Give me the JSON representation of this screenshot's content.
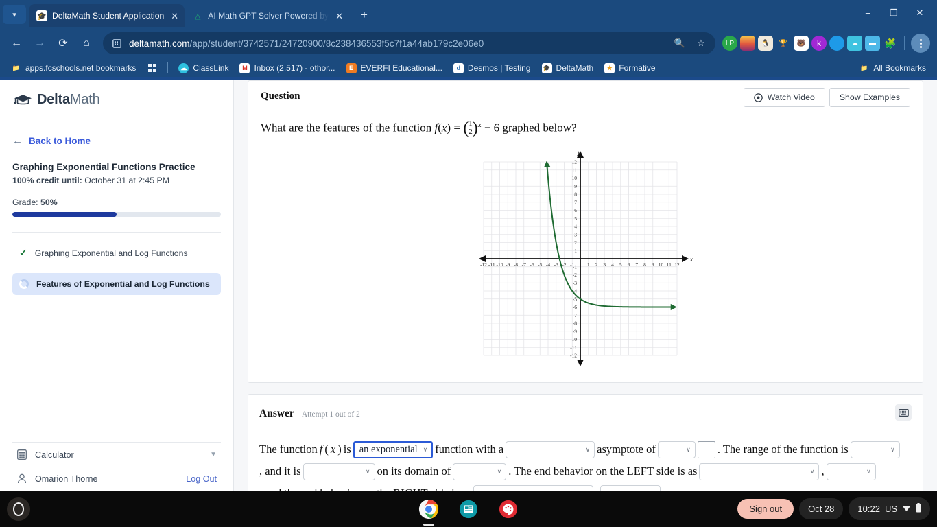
{
  "browser": {
    "tabs": [
      {
        "title": "DeltaMath Student Application",
        "favicon": "deltamath-icon",
        "active": true
      },
      {
        "title": "AI Math GPT Solver Powered by",
        "favicon": "compass-icon",
        "active": false
      }
    ],
    "newtab_label": "+",
    "window_controls": {
      "minimize": "−",
      "restore": "❐",
      "close": "✕"
    },
    "nav": {
      "back": "←",
      "forward": "→",
      "reload": "⟳",
      "home": "⌂"
    },
    "omnibox": {
      "domain": "deltamath.com",
      "path": "/app/student/3742571/24720900/8c238436553f5c7f1a44ab179c2e06e0",
      "site_icon": "page-info-icon",
      "search_icon": "search-icon",
      "bookmark_icon": "star-icon"
    },
    "extensions": [
      "lp-icon",
      "sunset-icon",
      "penguin-icon",
      "trophy-icon",
      "panda-icon",
      "k-icon",
      "pie-icon",
      "cloud-icon",
      "video-icon",
      "puzzle-icon"
    ],
    "menu_icon": "kebab-menu-icon",
    "bookmarks": [
      {
        "label": "apps.fcschools.net bookmarks",
        "icon": "folder-settings-icon"
      },
      {
        "label": "",
        "icon": "apps-grid-icon"
      },
      {
        "label": "ClassLink",
        "icon": "classlink-icon"
      },
      {
        "label": "Inbox (2,517) - othor...",
        "icon": "gmail-icon"
      },
      {
        "label": "EVERFI Educational...",
        "icon": "everfi-icon"
      },
      {
        "label": "Desmos | Testing",
        "icon": "desmos-icon"
      },
      {
        "label": "DeltaMath",
        "icon": "deltamath-icon"
      },
      {
        "label": "Formative",
        "icon": "formative-icon"
      }
    ],
    "all_bookmarks": {
      "label": "All Bookmarks",
      "icon": "folder-icon"
    }
  },
  "sidebar": {
    "logo": {
      "bold": "Delta",
      "light": "Math",
      "icon": "graduation-cap-icon"
    },
    "back_to_home": "Back to Home",
    "assignment_title": "Graphing Exponential Functions Practice",
    "credit_label": "100% credit until:",
    "credit_value": "October 31 at 2:45 PM",
    "grade_label": "Grade:",
    "grade_value": "50%",
    "grade_percent": 50,
    "problems": [
      {
        "label": "Graphing Exponential and Log Functions",
        "state": "complete",
        "icon": "check-icon"
      },
      {
        "label": "Features of Exponential and Log Functions",
        "state": "current",
        "icon": "spinner-icon"
      }
    ],
    "calculator": "Calculator",
    "user_name": "Omarion Thorne",
    "log_out": "Log Out"
  },
  "question": {
    "label": "Question",
    "watch_video": "Watch Video",
    "show_examples": "Show Examples",
    "text_before": "What are the features of the function",
    "fn_name": "f",
    "fn_var": "x",
    "equals": "=",
    "frac_num": "1",
    "frac_den": "2",
    "exponent": "x",
    "minus_const": "− 6",
    "text_after": "graphed below?"
  },
  "chart_data": {
    "type": "line",
    "title": "",
    "xlabel": "x",
    "ylabel": "y",
    "xlim": [
      -12,
      12
    ],
    "ylim": [
      -12,
      12
    ],
    "grid": true,
    "xticks": [
      -12,
      -11,
      -10,
      -9,
      -8,
      -7,
      -6,
      -5,
      -4,
      -3,
      -2,
      -1,
      1,
      2,
      3,
      4,
      5,
      6,
      7,
      8,
      9,
      10,
      11,
      12
    ],
    "yticks": [
      12,
      11,
      10,
      9,
      8,
      7,
      6,
      5,
      4,
      3,
      2,
      1,
      -1,
      -2,
      -3,
      -4,
      -5,
      -6,
      -7,
      -8,
      -9,
      -10,
      -11,
      -12
    ],
    "series": [
      {
        "name": "f(x) = (1/2)^x - 6",
        "color": "#1f6b32",
        "asymptote": -6,
        "y_intercept": -5,
        "x_intercept": -2.807,
        "points": [
          {
            "x": -4.17,
            "y": 12.0
          },
          {
            "x": -4.0,
            "y": 10.0
          },
          {
            "x": -3.5,
            "y": 5.31
          },
          {
            "x": -3.0,
            "y": 2.0
          },
          {
            "x": -2.807,
            "y": 0.0
          },
          {
            "x": -2.5,
            "y": -0.34
          },
          {
            "x": -2.0,
            "y": -2.0
          },
          {
            "x": -1.5,
            "y": -3.17
          },
          {
            "x": -1.0,
            "y": -4.0
          },
          {
            "x": -0.5,
            "y": -4.59
          },
          {
            "x": 0.0,
            "y": -5.0
          },
          {
            "x": 1.0,
            "y": -5.5
          },
          {
            "x": 2.0,
            "y": -5.75
          },
          {
            "x": 3.0,
            "y": -5.875
          },
          {
            "x": 4.0,
            "y": -5.94
          },
          {
            "x": 6.0,
            "y": -5.98
          },
          {
            "x": 9.0,
            "y": -6.0
          },
          {
            "x": 11.9,
            "y": -6.0
          }
        ]
      }
    ]
  },
  "answer": {
    "label": "Answer",
    "attempt": "Attempt 1 out of 2",
    "keyboard_icon": "keyboard-icon",
    "line1": {
      "t1": "The function",
      "fn": "f",
      "var": "x",
      "t2": "is",
      "d1_value": "an exponential",
      "t3": "function with a",
      "d2_value": "",
      "t4": "asymptote of",
      "d3_value": "",
      "input_value": "",
      "t5": ". The range of the function is"
    },
    "line2": {
      "d4_value": "",
      "t1": ", and it is",
      "d5_value": "",
      "t2": "on its domain of",
      "d6_value": "",
      "t3": ". The end behavior on the LEFT side is as",
      "d7_value": "",
      "t4": ","
    },
    "line3": {
      "d8_value": "",
      "t1": ", and the end behavior on the RIGHT side is as",
      "d9_value": "",
      "t2": ",",
      "d10_value": "",
      "t3": "."
    },
    "chevron": "∨"
  },
  "shelf": {
    "launcher": "launcher-icon",
    "apps": [
      "chrome-icon",
      "slides-icon",
      "paint-icon"
    ],
    "sign_out": "Sign out",
    "date": "Oct 28",
    "time": "10:22",
    "locale": "US",
    "wifi_icon": "wifi-icon",
    "battery_icon": "battery-icon"
  }
}
